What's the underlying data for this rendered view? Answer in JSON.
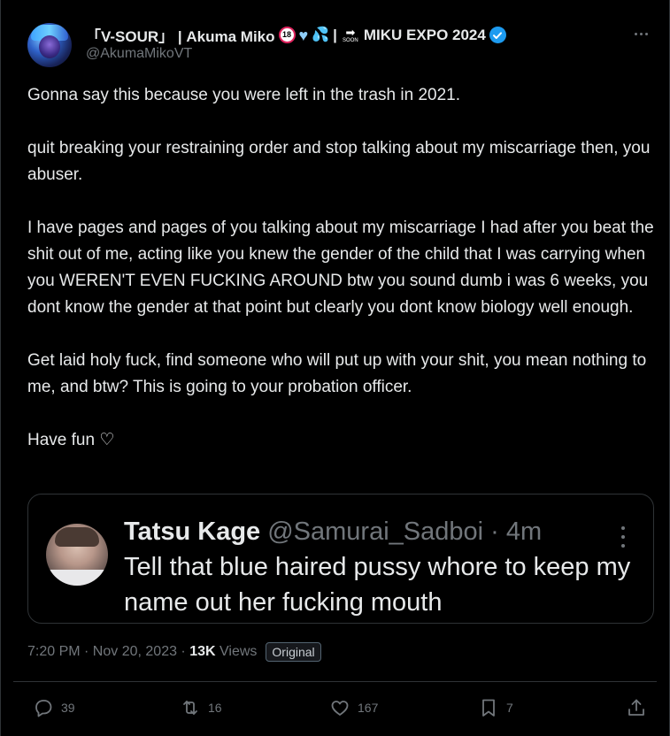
{
  "author": {
    "display_name": "「V-SOUR」 | Akuma Miko",
    "name_separator": "|",
    "name_tail": "MIKU EXPO 2024",
    "age_badge": "18",
    "soon_label": "SOON",
    "handle": "@AkumaMikoVT"
  },
  "post": {
    "paragraphs": [
      "Gonna say this because you were left in the trash in 2021.",
      "quit breaking your restraining order and stop talking about my miscarriage then, you abuser.",
      "I have pages and pages of you talking about my miscarriage I had after you beat the shit out of me, acting like you knew the gender of the child that I was carrying when you WEREN'T EVEN FUCKING AROUND btw you sound dumb i was 6 weeks, you dont know the gender at that point but clearly you dont know biology well enough.",
      "Get laid holy fuck, find someone who will put up with your shit, you mean nothing to me, and btw? This is going to your probation officer.",
      "Have fun ♡"
    ]
  },
  "quoted": {
    "name": "Tatsu Kage",
    "handle": "@Samurai_Sadboi",
    "time": "· 4m",
    "text": "Tell that blue haired pussy whore to keep my name out her fucking mouth"
  },
  "meta": {
    "time": "7:20 PM · Nov 20, 2023 · ",
    "views_count": "13K",
    "views_label": " Views",
    "badge": "Original"
  },
  "actions": {
    "replies": "39",
    "reposts": "16",
    "likes": "167",
    "bookmarks": "7"
  },
  "colors": {
    "background": "#000000",
    "text": "#e7e9ea",
    "muted": "#71767b",
    "verified": "#1d9bf0",
    "border": "#2f3336"
  },
  "icons": [
    "more-horizontal-icon",
    "verified-icon",
    "reply-icon",
    "repost-icon",
    "like-icon",
    "bookmark-icon",
    "share-icon"
  ]
}
